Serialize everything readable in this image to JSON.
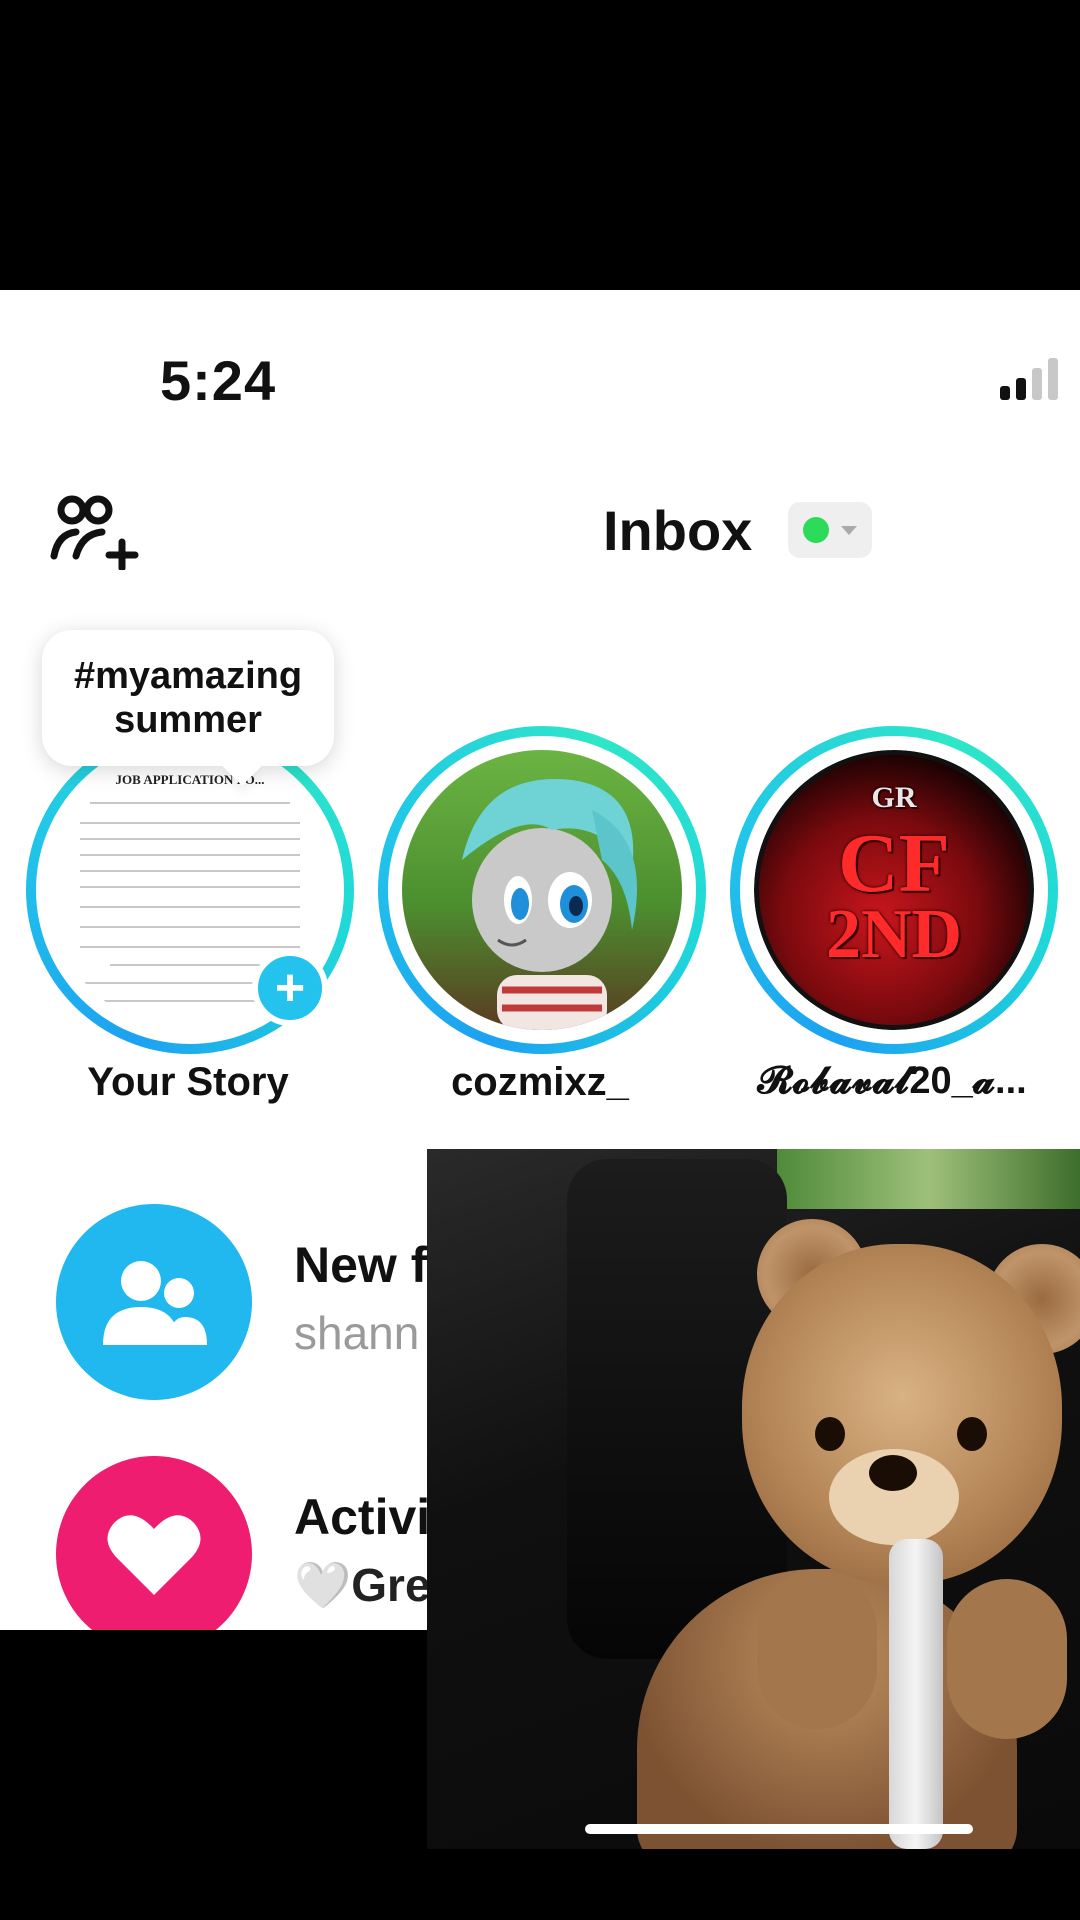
{
  "status_bar": {
    "time": "5:24"
  },
  "header": {
    "title": "Inbox",
    "add_friends_icon": "person-add-icon",
    "status_dot_color": "#2ddb5b"
  },
  "stories": {
    "tooltip": "#myamazing summer",
    "items": [
      {
        "label": "Your Story",
        "image": "job application form",
        "doc_title": "JOB APPLICATION FO..."
      },
      {
        "label": "cozmixz_",
        "image": "cartoon pony avatar"
      },
      {
        "label": "𝓡𝓸𝓫𝓪𝓿𝓪𝓵20_𝓪...",
        "image": "CF 2ND logo",
        "logo_small": "GR",
        "logo_line1": "CF",
        "logo_line2": "2ND"
      }
    ]
  },
  "list": {
    "items": [
      {
        "title": "New f",
        "subtitle": "shann",
        "icon": "people-icon",
        "color": "#20b8ee"
      },
      {
        "title": "Activi",
        "subtitle": "🤍Gre",
        "icon": "heart-icon",
        "color": "#ee1d6f"
      }
    ]
  },
  "video_overlay": {
    "content": "teddy bear in car"
  }
}
